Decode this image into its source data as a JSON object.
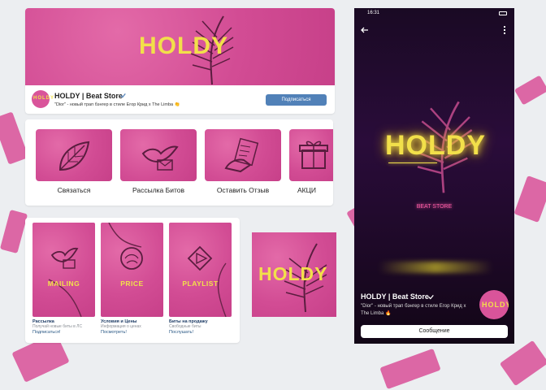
{
  "colors": {
    "brand_pink": "#d9549a",
    "logo_yellow": "#f2e04a",
    "vk_blue": "#5181b8"
  },
  "desktop": {
    "cover_logo": "HOLDY",
    "group_name": "HOLDY | Beat Store",
    "status": "\"Dior\" - новый трап бэнгер в стиле Егор Крид x The Limba 👏",
    "subscribe_label": "Подписаться",
    "menu": [
      {
        "label": "Связаться",
        "icon": "leaf-icon"
      },
      {
        "label": "Рассылка Битов",
        "icon": "dove-mail-icon"
      },
      {
        "label": "Оставить Отзыв",
        "icon": "hand-writing-icon"
      },
      {
        "label": "АКЦИ",
        "icon": "gift-icon"
      }
    ],
    "wiki": [
      {
        "word": "MAILING",
        "title": "Рассылка",
        "sub": "Получай новые биты в ЛС",
        "link": "Подписаться!",
        "icon": "dove-mail-icon"
      },
      {
        "word": "PRICE",
        "title": "Условия и Цены",
        "sub": "Информация о ценах",
        "link": "Посмотреть!",
        "icon": "cabbage-icon"
      },
      {
        "word": "PLAYLIST",
        "title": "Биты на продажу",
        "sub": "Свободные биты",
        "link": "Послушать!",
        "icon": "play-diamond-icon"
      }
    ],
    "avatar_logo": "HOLDY"
  },
  "mobile": {
    "time": "16:31",
    "logo": "HOLDY",
    "subtitle": "BEAT STORE",
    "group_name": "HOLDY | Beat Store",
    "status": "\"Dior\" - новый трап бэнгер в стиле Егор Крид x The Limba 🔥",
    "avatar_logo": "HOLDY",
    "message_label": "Сообщение"
  }
}
